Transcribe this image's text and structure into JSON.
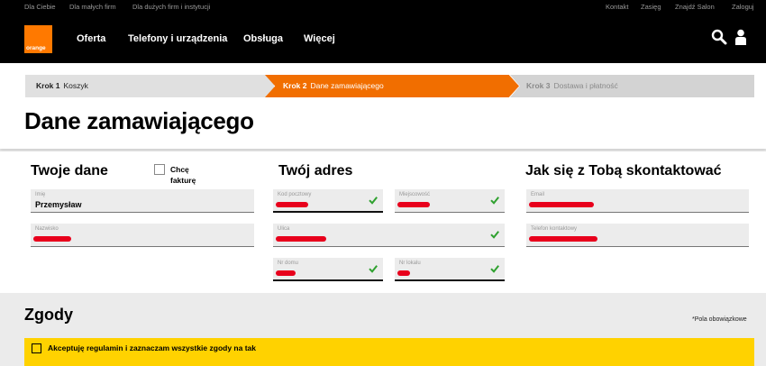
{
  "topbar": {
    "left_links": [
      "Dla Ciebie",
      "Dla małych firm",
      "Dla dużych firm i instytucji"
    ],
    "right_links": [
      "Kontakt",
      "Zasięg",
      "Znajdź Salon",
      "Zaloguj"
    ]
  },
  "brand": {
    "logo_text": "orange",
    "accent": "#ff7900"
  },
  "nav": {
    "items": [
      "Oferta",
      "Telefony i urządzenia",
      "Obsługa",
      "Więcej"
    ],
    "icons": [
      "search-icon",
      "user-icon"
    ]
  },
  "steps": [
    {
      "num": "Krok 1",
      "label": "Koszyk",
      "state": "done"
    },
    {
      "num": "Krok 2",
      "label": "Dane zamawiającego",
      "state": "active"
    },
    {
      "num": "Krok 3",
      "label": "Dostawa i płatność",
      "state": "pending"
    }
  ],
  "page_title": "Dane zamawiającego",
  "sections": {
    "your_data": {
      "title": "Twoje dane",
      "invoice_checkbox_label": [
        "Chcę",
        "fakturę"
      ],
      "fields": {
        "first_name": {
          "label": "Imię",
          "value": "Przemysław"
        },
        "last_name": {
          "label": "Nazwisko",
          "value": "[redacted]"
        }
      }
    },
    "your_address": {
      "title": "Twój adres",
      "fields": {
        "postal_code": {
          "label": "Kod pocztowy",
          "value": "[redacted]",
          "valid": true
        },
        "city": {
          "label": "Miejscowość",
          "value": "[redacted]",
          "valid": true
        },
        "street": {
          "label": "Ulica",
          "value": "[redacted]",
          "valid": true
        },
        "house_no": {
          "label": "Nr domu",
          "value": "[redacted]",
          "valid": true
        },
        "flat_no": {
          "label": "Nr lokalu",
          "value": "[redacted]",
          "valid": true
        }
      }
    },
    "contact": {
      "title": "Jak się z Tobą skontaktować",
      "fields": {
        "email": {
          "label": "Email",
          "value": "[redacted]"
        },
        "phone": {
          "label": "Telefon kontaktowy",
          "value": "[redacted]"
        }
      }
    }
  },
  "consents": {
    "title": "Zgody",
    "required_note": "*Pola obowiązkowe",
    "accept_all_label": "Akceptuję regulamin i zaznaczam wszystkie zgody na tak",
    "accept_all_checked": false
  },
  "colors": {
    "active_step": "#f16e00",
    "valid_check": "#2fa12f",
    "consent_bar": "#ffd200",
    "redaction": "#e8001c"
  }
}
